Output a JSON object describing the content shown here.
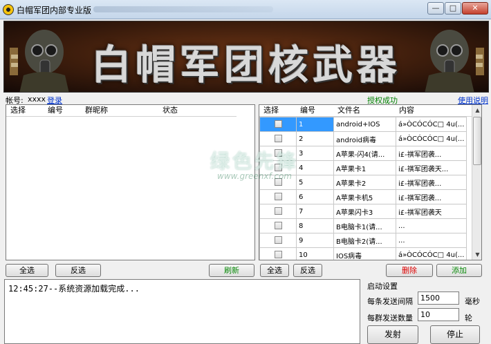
{
  "window": {
    "title": "白帽军团内部专业版",
    "controls": {
      "minimize": "—",
      "maximize": "□",
      "close": "✕"
    }
  },
  "banner": {
    "title": "白帽军团核武器"
  },
  "account": {
    "label": "帐号:",
    "value": "xxxx",
    "login_link": "登录",
    "auth_status": "授权成功",
    "help_link": "使用说明"
  },
  "left_table": {
    "headers": [
      "选择",
      "编号",
      "群昵称",
      "状态"
    ]
  },
  "right_table": {
    "headers": [
      "选择",
      "编号",
      "文件名",
      "内容"
    ],
    "rows": [
      {
        "id": "1",
        "filename": "android+IOS",
        "content": "á»ÒCÓCÓC□ 4u(...",
        "selected": true
      },
      {
        "id": "2",
        "filename": "android病毒",
        "content": "á»ÒCÓCÓC□ 4u(...",
        "selected": false
      },
      {
        "id": "3",
        "filename": "A苹果-闪4(请...",
        "content": "i£-祺军团袭...",
        "selected": false
      },
      {
        "id": "4",
        "filename": "A苹果卡1",
        "content": "i£-祺军团袭天...",
        "selected": false
      },
      {
        "id": "5",
        "filename": "A苹果卡2",
        "content": "i£-祺军团袭...",
        "selected": false
      },
      {
        "id": "6",
        "filename": "A苹果卡机5",
        "content": "i£-祺军团袭...",
        "selected": false
      },
      {
        "id": "7",
        "filename": "A苹果闪卡3",
        "content": "i£-祺军团袭天",
        "selected": false
      },
      {
        "id": "8",
        "filename": "B电脑卡1(请...",
        "content": "...",
        "selected": false
      },
      {
        "id": "9",
        "filename": "B电脑卡2(请...",
        "content": "...",
        "selected": false
      },
      {
        "id": "10",
        "filename": "IOS病毒",
        "content": "á»ÒCÓCÓC□ 4u(...",
        "selected": false
      }
    ]
  },
  "left_buttons": {
    "select_all": "全选",
    "invert": "反选",
    "refresh": "刷新"
  },
  "right_buttons": {
    "select_all": "全选",
    "invert": "反选",
    "delete": "删除",
    "add": "添加"
  },
  "log": {
    "text": "12:45:27--系统资源加载完成..."
  },
  "settings": {
    "title": "启动设置",
    "interval_label": "每条发送间隔",
    "interval_value": "1500",
    "interval_unit": "毫秒",
    "count_label": "每群发送数量",
    "count_value": "10",
    "count_unit": "轮",
    "fire_button": "发射",
    "stop_button": "停止"
  },
  "watermark": {
    "main": "绿色先锋",
    "sub": "www.greenxf.com"
  },
  "colors": {
    "accent_green": "#008000",
    "link_blue": "#0033cc",
    "selection": "#3399ff",
    "delete_red": "#dd0000"
  }
}
